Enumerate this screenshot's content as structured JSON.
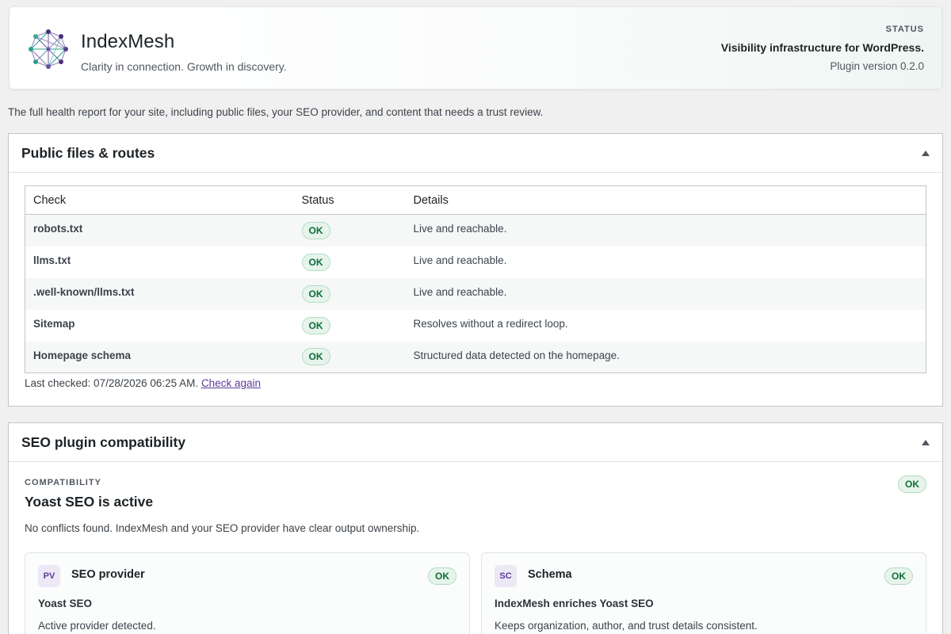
{
  "brand": {
    "name": "IndexMesh",
    "tagline": "Clarity in connection. Growth in discovery.",
    "status_label": "STATUS",
    "status_headline": "Visibility infrastructure for WordPress.",
    "version_text": "Plugin version 0.2.0"
  },
  "intro": "The full health report for your site, including public files, your SEO provider, and content that needs a trust review.",
  "public_files": {
    "title": "Public files & routes",
    "columns": {
      "check": "Check",
      "status": "Status",
      "details": "Details"
    },
    "rows": [
      {
        "check": "robots.txt",
        "status": "OK",
        "details": "Live and reachable."
      },
      {
        "check": "llms.txt",
        "status": "OK",
        "details": "Live and reachable."
      },
      {
        "check": ".well-known/llms.txt",
        "status": "OK",
        "details": "Live and reachable."
      },
      {
        "check": "Sitemap",
        "status": "OK",
        "details": "Resolves without a redirect loop."
      },
      {
        "check": "Homepage schema",
        "status": "OK",
        "details": "Structured data detected on the homepage."
      }
    ],
    "last_checked": "Last checked: 07/28/2026 06:25 AM.",
    "check_again": "Check again"
  },
  "seo_compat": {
    "title": "SEO plugin compatibility",
    "eyebrow": "COMPATIBILITY",
    "headline": "Yoast SEO is active",
    "status": "OK",
    "description": "No conflicts found. IndexMesh and your SEO provider have clear output ownership.",
    "cards": [
      {
        "chip": "PV",
        "title": "SEO provider",
        "status": "OK",
        "value": "Yoast SEO",
        "description": "Active provider detected."
      },
      {
        "chip": "SC",
        "title": "Schema",
        "status": "OK",
        "value": "IndexMesh enriches Yoast SEO",
        "description": "Keeps organization, author, and trust details consistent."
      }
    ]
  },
  "colors": {
    "ok_text": "#0e6d38",
    "ok_bg": "#e6f4ec",
    "link": "#5b3d99",
    "logo_teal": "#2e9e8f",
    "logo_purple": "#4b2f7a"
  }
}
